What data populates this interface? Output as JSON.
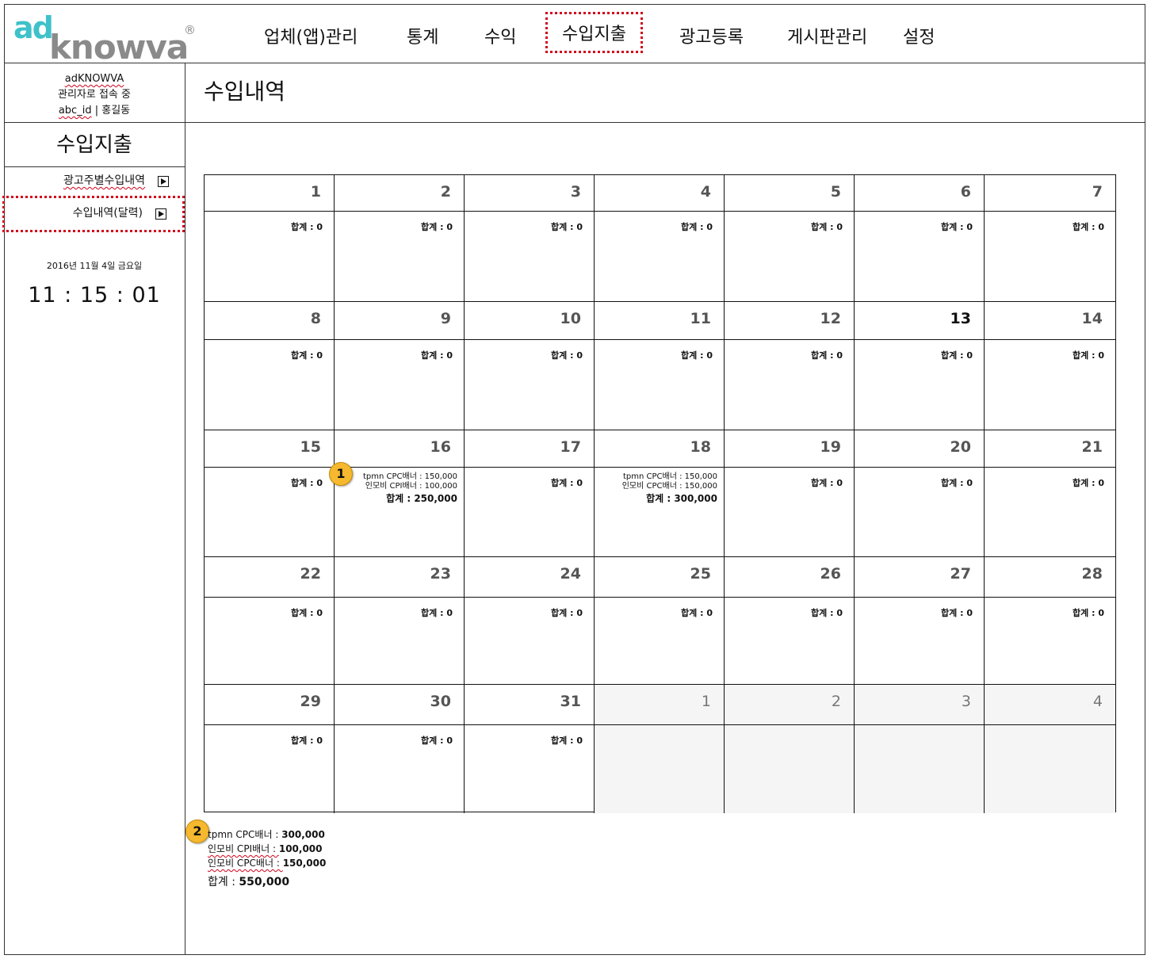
{
  "logo": {
    "ad": "ad",
    "knowva": "knowva",
    "reg": "®",
    "ad_color": "#3fc1c9",
    "knowva_color": "#8a8a8a"
  },
  "nav": {
    "items": [
      {
        "label": "업체(앱)관리"
      },
      {
        "label": "통계"
      },
      {
        "label": "수익"
      },
      {
        "label": "수입지출",
        "active": true
      },
      {
        "label": "광고등록"
      },
      {
        "label": "게시판관리"
      },
      {
        "label": "설정"
      }
    ]
  },
  "user": {
    "company": "adKNOWVA",
    "status": "관리자로 접속 중",
    "id": "abc_id",
    "separator": "|",
    "name": "홍길동"
  },
  "sidebar": {
    "title": "수입지출",
    "links": [
      {
        "label": "광고주별수입내역"
      },
      {
        "label": "수입내역(달력)",
        "active": true
      }
    ],
    "date": "2016년 11월 4일 금요일",
    "clock": "11 : 15 : 01"
  },
  "main": {
    "title": "수입내역"
  },
  "calendar": {
    "sum_label": "합계 : 0",
    "days": [
      "1",
      "2",
      "3",
      "4",
      "5",
      "6",
      "7",
      "8",
      "9",
      "10",
      "11",
      "12",
      "13",
      "14",
      "15",
      "16",
      "17",
      "18",
      "19",
      "20",
      "21",
      "22",
      "23",
      "24",
      "25",
      "26",
      "27",
      "28",
      "29",
      "30",
      "31",
      "1",
      "2",
      "3",
      "4"
    ],
    "today": "13",
    "details": {
      "16": {
        "lines": [
          "tpmn CPC배너 : 150,000",
          "인모비 CPI배너 : 100,000"
        ],
        "total": "합계 : 250,000"
      },
      "18": {
        "lines": [
          "tpmn CPC배너 : 150,000",
          "인모비 CPC배너 : 150,000"
        ],
        "total": "합계 : 300,000"
      }
    }
  },
  "badges": {
    "one": "1",
    "two": "2"
  },
  "summary": {
    "lines": [
      {
        "name": "tpmn CPC배너 : ",
        "value": "300,000"
      },
      {
        "name": "인모비 CPI배너 : ",
        "value": "100,000"
      },
      {
        "name": "인모비 CPC배너 : ",
        "value": "150,000"
      }
    ],
    "total_label": "합계 : ",
    "total_value": "550,000"
  }
}
